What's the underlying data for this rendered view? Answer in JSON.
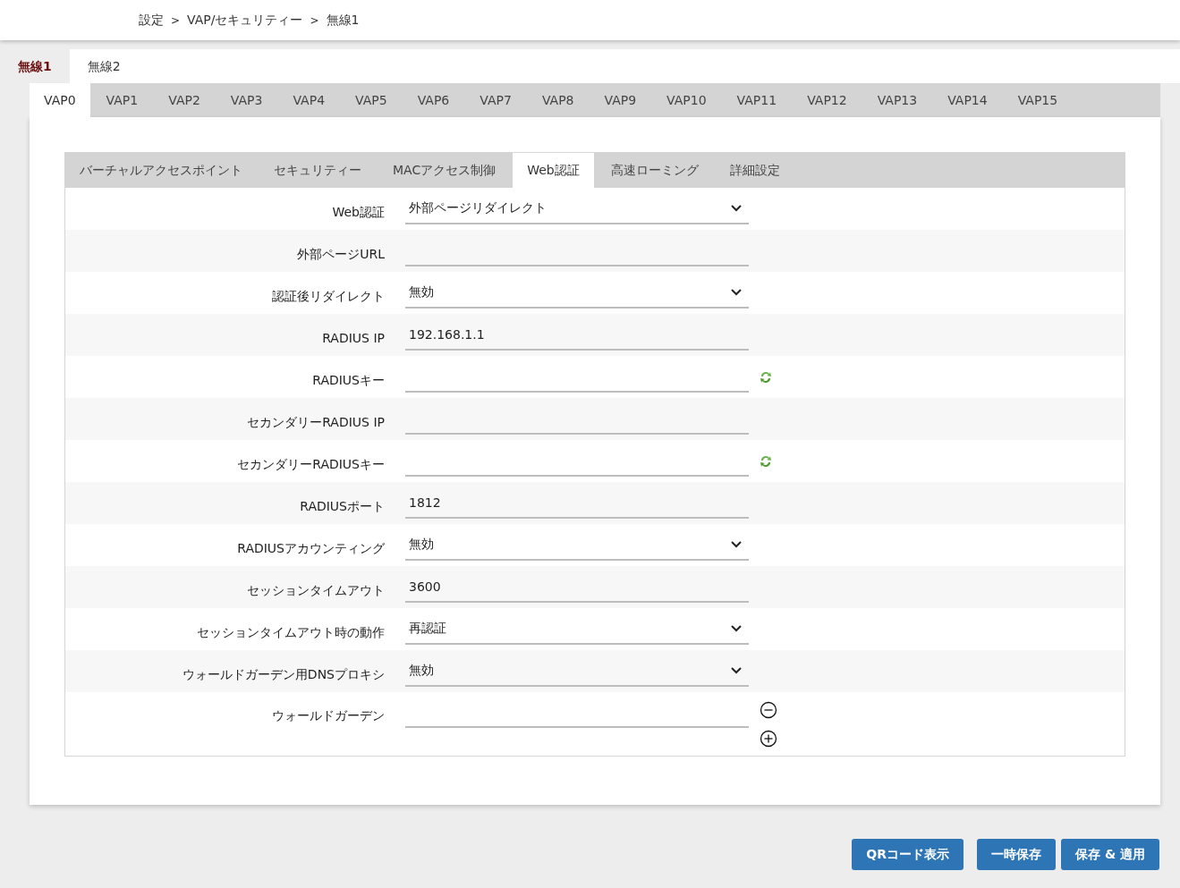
{
  "breadcrumb": [
    "設定",
    "VAP/セキュリティー",
    "無線1"
  ],
  "breadcrumb_separator": ">",
  "radio_tabs": [
    {
      "label": "無線1",
      "selected": true
    },
    {
      "label": "無線2",
      "selected": false
    }
  ],
  "vap_tabs": [
    {
      "label": "VAP0",
      "selected": true
    },
    {
      "label": "VAP1",
      "selected": false
    },
    {
      "label": "VAP2",
      "selected": false
    },
    {
      "label": "VAP3",
      "selected": false
    },
    {
      "label": "VAP4",
      "selected": false
    },
    {
      "label": "VAP5",
      "selected": false
    },
    {
      "label": "VAP6",
      "selected": false
    },
    {
      "label": "VAP7",
      "selected": false
    },
    {
      "label": "VAP8",
      "selected": false
    },
    {
      "label": "VAP9",
      "selected": false
    },
    {
      "label": "VAP10",
      "selected": false
    },
    {
      "label": "VAP11",
      "selected": false
    },
    {
      "label": "VAP12",
      "selected": false
    },
    {
      "label": "VAP13",
      "selected": false
    },
    {
      "label": "VAP14",
      "selected": false
    },
    {
      "label": "VAP15",
      "selected": false
    }
  ],
  "section_tabs": [
    {
      "label": "バーチャルアクセスポイント",
      "selected": false
    },
    {
      "label": "セキュリティー",
      "selected": false
    },
    {
      "label": "MACアクセス制御",
      "selected": false
    },
    {
      "label": "Web認証",
      "selected": true
    },
    {
      "label": "高速ローミング",
      "selected": false
    },
    {
      "label": "詳細設定",
      "selected": false
    }
  ],
  "form": [
    {
      "label": "Web認証",
      "kind": "select",
      "value": "外部ページリダイレクト"
    },
    {
      "label": "外部ページURL",
      "kind": "input"
    },
    {
      "label": "認証後リダイレクト",
      "kind": "select",
      "value": "無効"
    },
    {
      "label": "RADIUS IP",
      "kind": "input",
      "value": "192.168.1.1"
    },
    {
      "label": "RADIUSキー",
      "kind": "key"
    },
    {
      "label": "セカンダリーRADIUS IP",
      "kind": "input"
    },
    {
      "label": "セカンダリーRADIUSキー",
      "kind": "key"
    },
    {
      "label": "RADIUSポート",
      "kind": "input",
      "value": "1812"
    },
    {
      "label": "RADIUSアカウンティング",
      "kind": "select",
      "value": "無効"
    },
    {
      "label": "セッションタイムアウト",
      "kind": "input",
      "value": "3600"
    },
    {
      "label": "セッションタイムアウト時の動作",
      "kind": "select",
      "value": "再認証"
    },
    {
      "label": "ウォールドガーデン用DNSプロキシ",
      "kind": "select",
      "value": "無効"
    },
    {
      "label": "ウォールドガーデン",
      "kind": "list"
    }
  ],
  "buttons": [
    "QRコード表示",
    "一時保存",
    "保存 & 適用"
  ]
}
